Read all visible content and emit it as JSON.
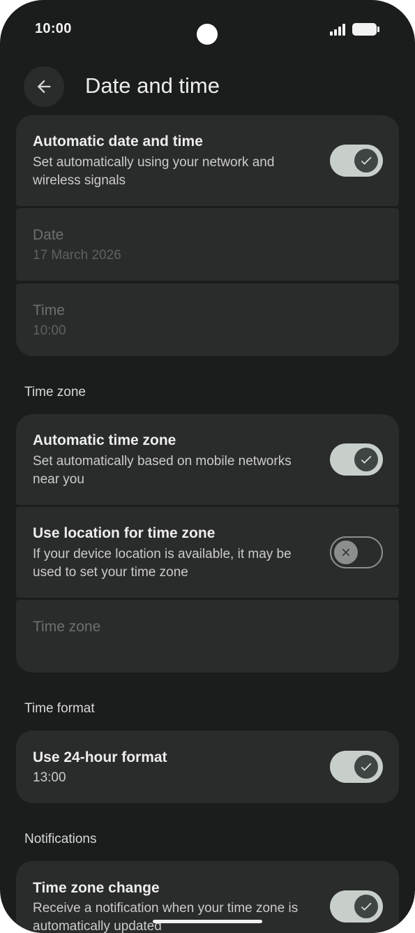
{
  "status_bar": {
    "time": "10:00"
  },
  "header": {
    "title": "Date and time"
  },
  "auto_date": {
    "title": "Automatic date and time",
    "subtitle": "Set automatically using your network and wireless signals",
    "enabled": true
  },
  "date_item": {
    "title": "Date",
    "value": "17 March 2026"
  },
  "time_item": {
    "title": "Time",
    "value": "10:00"
  },
  "sections": {
    "time_zone": "Time zone",
    "time_format": "Time format",
    "notifications": "Notifications"
  },
  "auto_tz": {
    "title": "Automatic time zone",
    "subtitle": "Set automatically based on mobile networks near you",
    "enabled": true
  },
  "location_tz": {
    "title": "Use location for time zone",
    "subtitle": "If your device location is available, it may be used to set your time zone",
    "enabled": false
  },
  "tz_item": {
    "title": "Time zone"
  },
  "format_24h": {
    "title": "Use 24-hour format",
    "subtitle": "13:00",
    "enabled": true
  },
  "tz_change": {
    "title": "Time zone change",
    "subtitle": "Receive a notification when your time zone is automatically updated",
    "enabled": true
  },
  "icons": {
    "back": "arrow-back-icon",
    "check": "check-icon",
    "close": "close-icon",
    "signal": "signal-icon",
    "battery": "battery-icon"
  },
  "colors": {
    "background": "#1b1c1c",
    "card": "#2a2b2b",
    "toggle_on_track": "#c8cfca",
    "toggle_on_knob": "#3f4543",
    "toggle_off_outline": "#8c8e8d"
  }
}
